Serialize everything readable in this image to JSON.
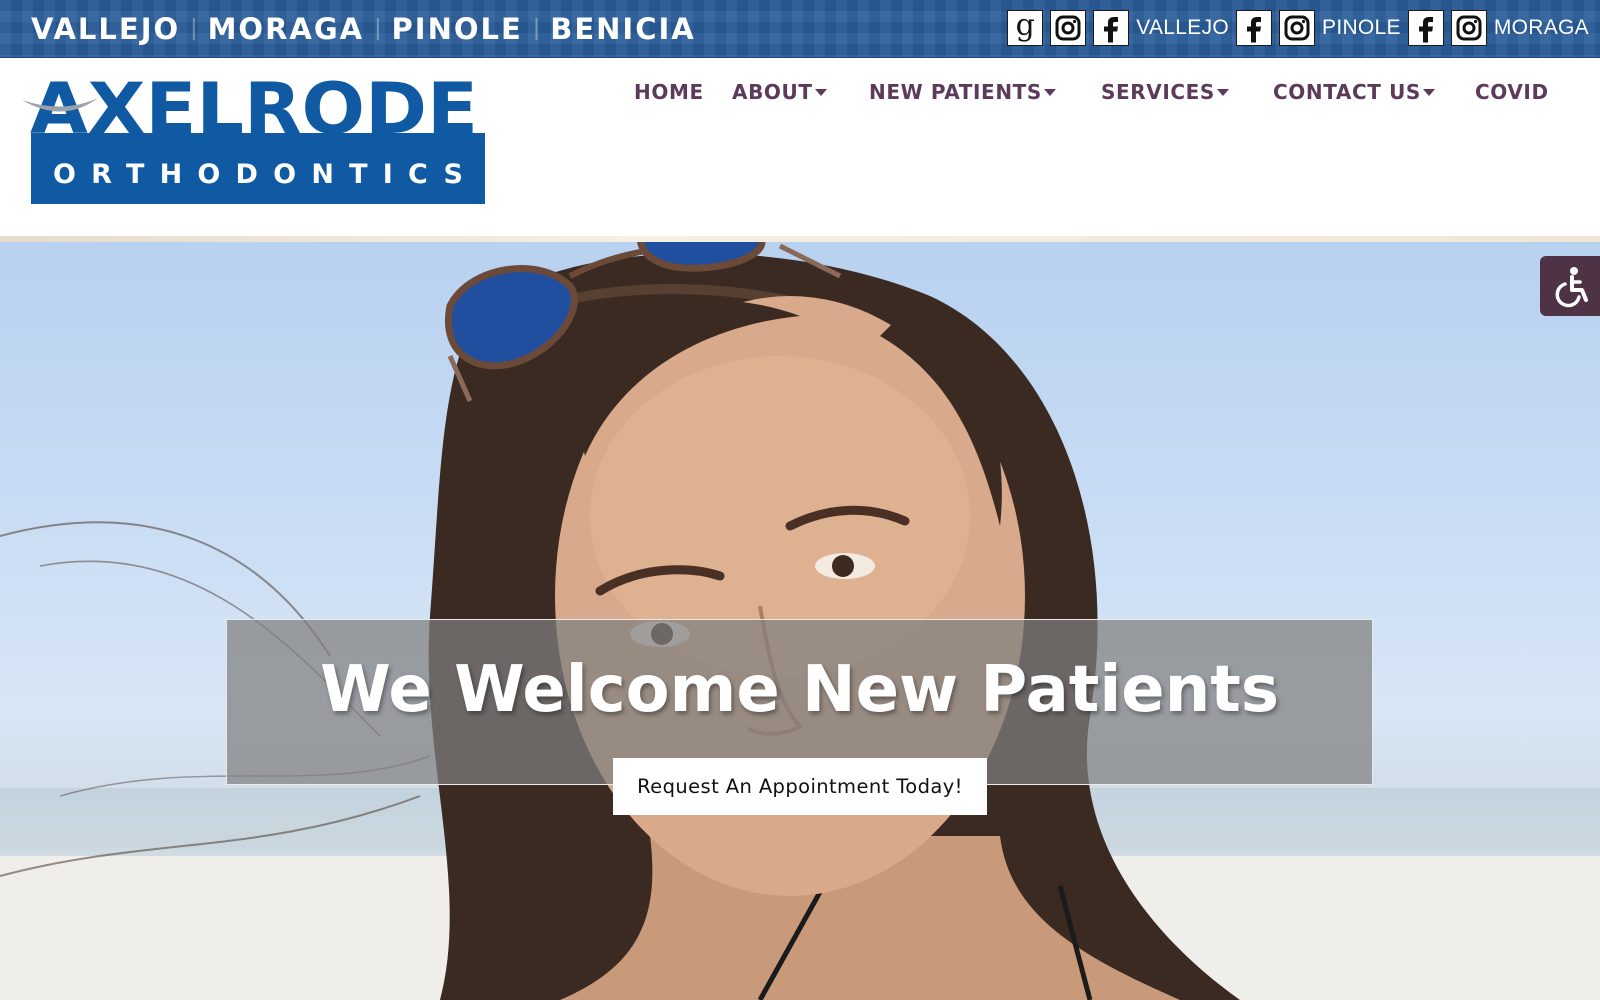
{
  "top_bar": {
    "cities": [
      "VALLEJO",
      "MORAGA",
      "PINOLE",
      "BENICIA"
    ],
    "separator": "|",
    "socials": {
      "location_labels": [
        "VALLEJO",
        "PINOLE",
        "MORAGA"
      ],
      "google_glyph": "g",
      "icons": [
        "google-icon",
        "instagram-icon",
        "facebook-icon"
      ]
    }
  },
  "logo": {
    "name": "AXELRODE",
    "tagline": "ORTHODONTICS",
    "colors": {
      "primary": "#0f5aa3",
      "smile": "#9aa3ad"
    }
  },
  "nav": {
    "items": [
      {
        "label": "HOME",
        "has_dropdown": false
      },
      {
        "label": "ABOUT",
        "has_dropdown": true
      },
      {
        "label": "NEW PATIENTS",
        "has_dropdown": true
      },
      {
        "label": "SERVICES",
        "has_dropdown": true
      },
      {
        "label": "CONTACT US",
        "has_dropdown": true
      },
      {
        "label": "COVID",
        "has_dropdown": false
      }
    ],
    "color": "#5b3a5a"
  },
  "hero": {
    "title": "We Welcome New Patients",
    "cta_label": "Request An Appointment Today!",
    "image_semantic": "smiling-woman-on-beach"
  },
  "accessibility": {
    "icon": "wheelchair-icon",
    "color": "#4d3345"
  },
  "colors": {
    "top_bar_bg": "#2a5d99",
    "nav_text": "#5b3a5a"
  }
}
